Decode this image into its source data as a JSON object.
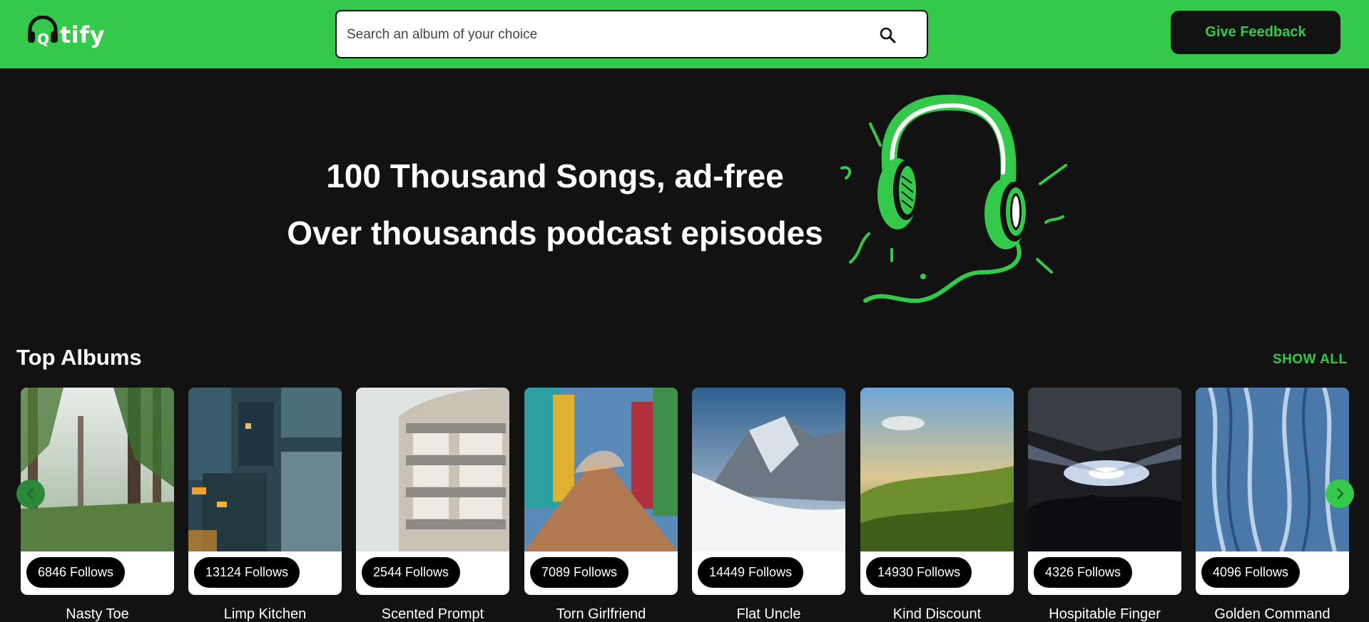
{
  "header": {
    "logo_text": "tify",
    "search_placeholder": "Search an album of your choice",
    "feedback_label": "Give Feedback"
  },
  "hero": {
    "line1": "100 Thousand Songs, ad-free",
    "line2": "Over thousands podcast episodes"
  },
  "section": {
    "title": "Top Albums",
    "show_all": "SHOW ALL"
  },
  "albums": [
    {
      "follows": "6846 Follows",
      "name": "Nasty Toe"
    },
    {
      "follows": "13124 Follows",
      "name": "Limp Kitchen"
    },
    {
      "follows": "2544 Follows",
      "name": "Scented Prompt"
    },
    {
      "follows": "7089 Follows",
      "name": "Torn Girlfriend"
    },
    {
      "follows": "14449 Follows",
      "name": "Flat Uncle"
    },
    {
      "follows": "14930 Follows",
      "name": "Kind Discount"
    },
    {
      "follows": "4326 Follows",
      "name": "Hospitable Finger"
    },
    {
      "follows": "4096 Follows",
      "name": "Golden Command"
    }
  ],
  "colors": {
    "accent": "#34c94b",
    "background": "#121212"
  }
}
